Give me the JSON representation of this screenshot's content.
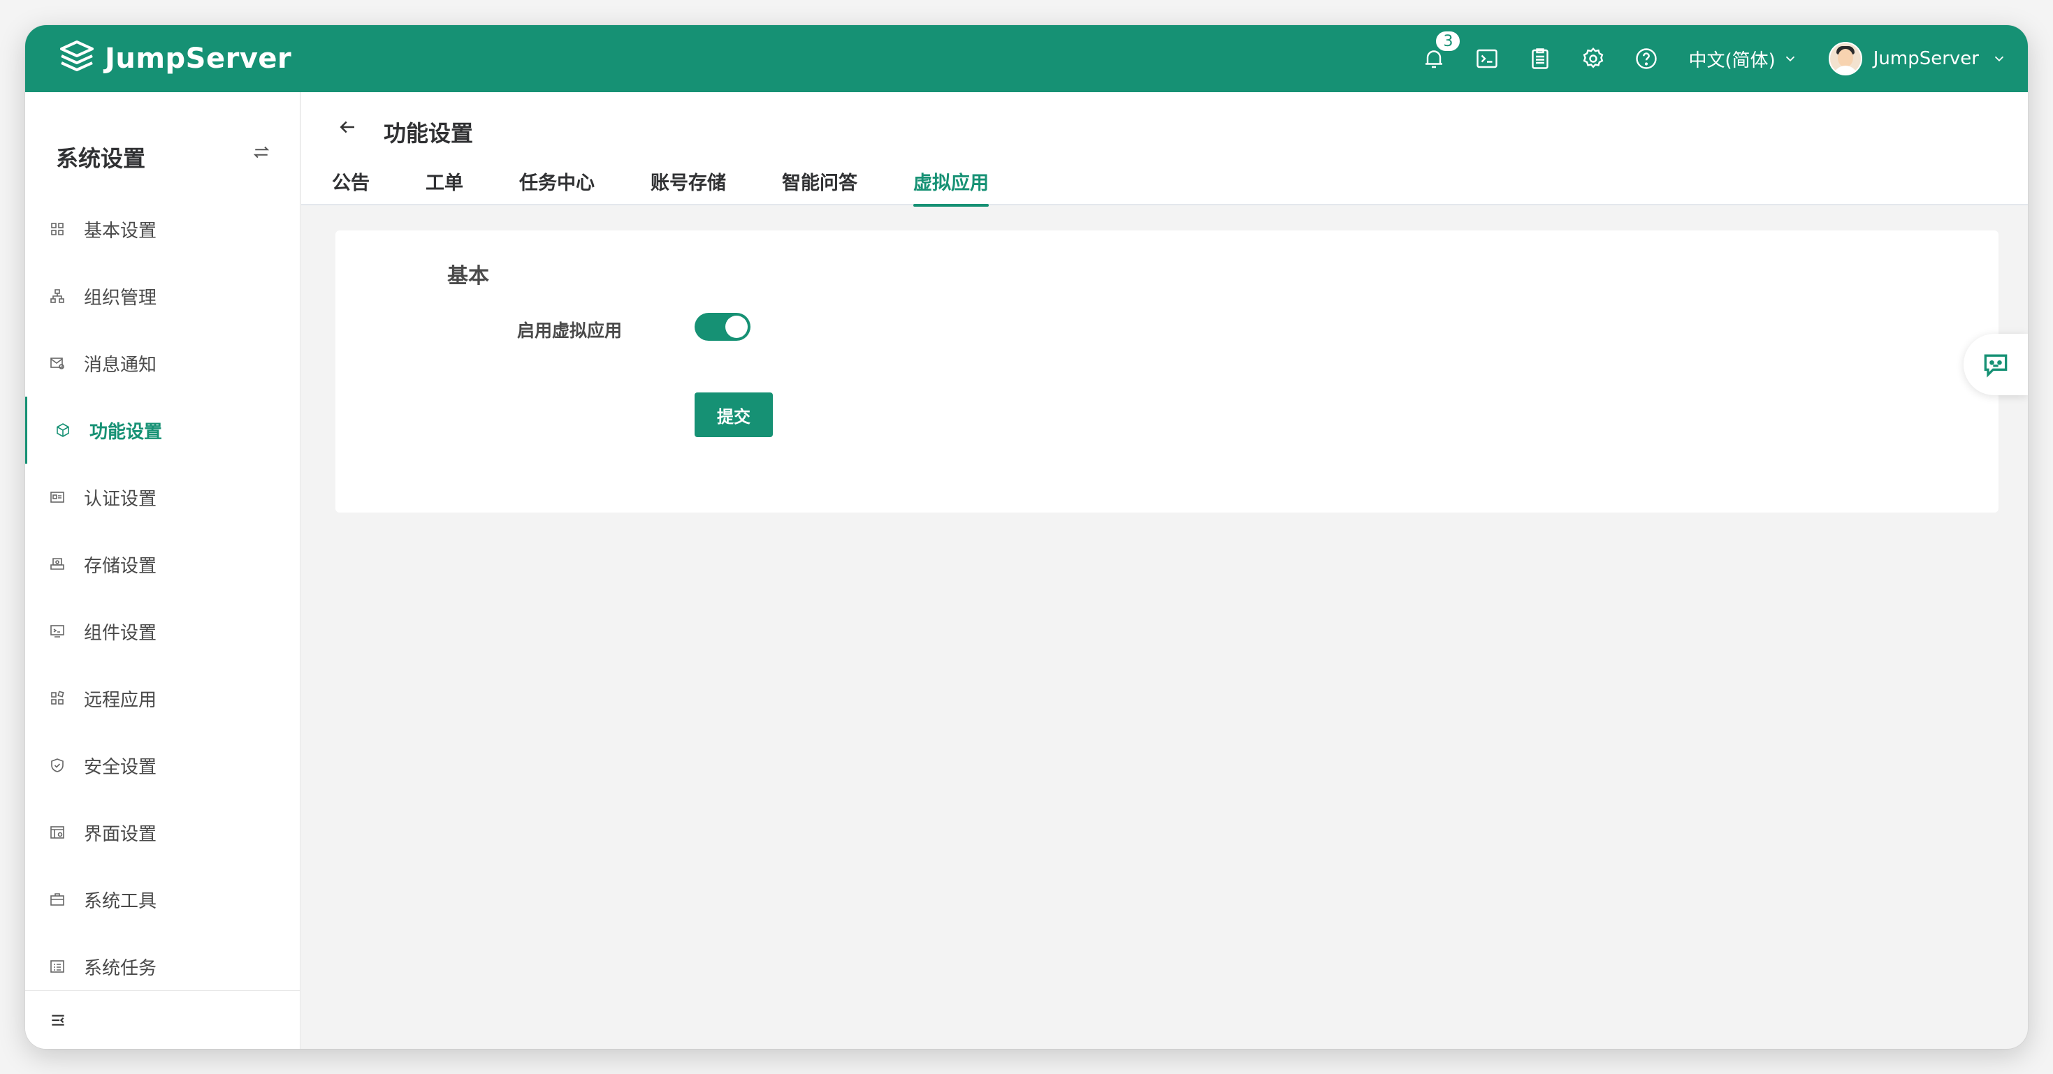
{
  "brand": {
    "name": "JumpServer",
    "color": "#169174"
  },
  "topbar": {
    "notification_count": "3",
    "icons": [
      "bell-icon",
      "terminal-icon",
      "clipboard-icon",
      "gear-icon",
      "help-icon"
    ],
    "language": "中文(简体)",
    "username": "JumpServer"
  },
  "sidebar": {
    "title": "系统设置",
    "items": [
      {
        "label": "基本设置",
        "icon": "grid-icon"
      },
      {
        "label": "组织管理",
        "icon": "org-icon"
      },
      {
        "label": "消息通知",
        "icon": "message-icon"
      },
      {
        "label": "功能设置",
        "icon": "cube-icon",
        "active": true
      },
      {
        "label": "认证设置",
        "icon": "id-card-icon"
      },
      {
        "label": "存储设置",
        "icon": "storage-icon"
      },
      {
        "label": "组件设置",
        "icon": "component-icon"
      },
      {
        "label": "远程应用",
        "icon": "apps-icon"
      },
      {
        "label": "安全设置",
        "icon": "shield-icon"
      },
      {
        "label": "界面设置",
        "icon": "interface-icon"
      },
      {
        "label": "系统工具",
        "icon": "toolbox-icon"
      },
      {
        "label": "系统任务",
        "icon": "task-icon"
      }
    ]
  },
  "page": {
    "title": "功能设置",
    "tabs": [
      "公告",
      "工单",
      "任务中心",
      "账号存储",
      "智能问答",
      "虚拟应用"
    ],
    "active_tab": "虚拟应用"
  },
  "form": {
    "section_title": "基本",
    "field_label": "启用虚拟应用",
    "switch_on": true,
    "submit_label": "提交"
  }
}
